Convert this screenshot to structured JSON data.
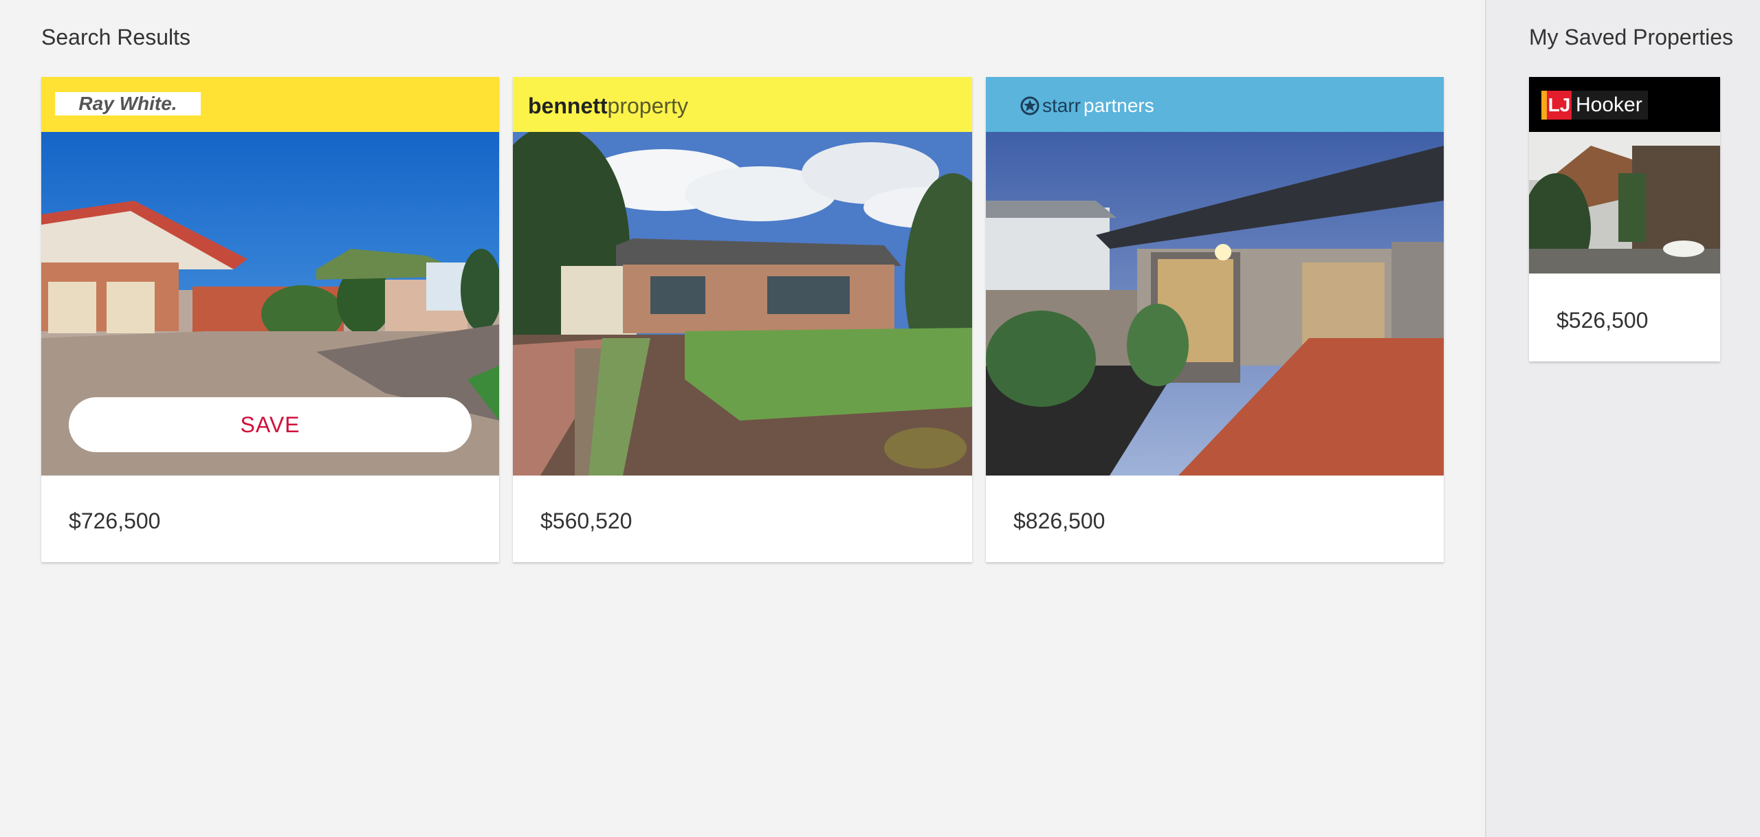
{
  "search_results": {
    "title": "Search Results",
    "cards": [
      {
        "agency": "Ray White.",
        "brand_color": "#ffe234",
        "price": "$726,500",
        "save_label": "SAVE"
      },
      {
        "agency_bold": "bennett",
        "agency_light": "property",
        "brand_color": "#fcf34a",
        "price": "$560,520"
      },
      {
        "agency_a": "starr",
        "agency_b": "partners",
        "brand_color": "#5ab4dc",
        "price": "$826,500"
      }
    ]
  },
  "saved_properties": {
    "title": "My Saved Properties",
    "cards": [
      {
        "agency_a": "LJ",
        "agency_b": "Hooker",
        "brand_color": "#000000",
        "price": "$526,500"
      }
    ]
  },
  "colors": {
    "accent": "#d0103a",
    "background": "#f3f3f3",
    "sidebar_background": "#ececee"
  }
}
